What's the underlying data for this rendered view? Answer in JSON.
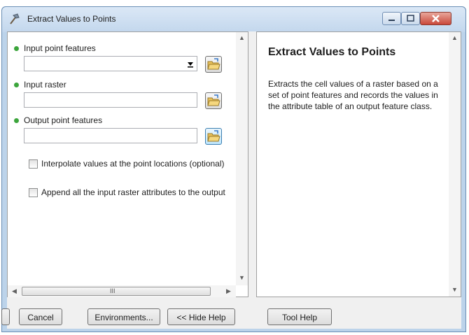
{
  "window": {
    "title": "Extract Values to Points"
  },
  "params": [
    {
      "label": "Input point features",
      "value": "",
      "kind": "combo"
    },
    {
      "label": "Input raster",
      "value": "",
      "kind": "text"
    },
    {
      "label": "Output point features",
      "value": "",
      "kind": "text"
    }
  ],
  "options": [
    {
      "label": "Interpolate values at the point locations (optional)",
      "checked": false
    },
    {
      "label": "Append all the input raster attributes to the output point features (optional)",
      "checked": false
    }
  ],
  "scrollbar": {
    "grip": "III"
  },
  "help": {
    "title": "Extract Values to Points",
    "body": "Extracts the cell values of a raster based on a set of point features and records the values in the attribute table of an output feature class."
  },
  "buttons": {
    "cancel": "Cancel",
    "environments": "Environments...",
    "hide_help": "<< Hide Help",
    "tool_help": "Tool Help"
  },
  "colors": {
    "required_dot": "#3ca53c",
    "title_bar": "#c3d7ed",
    "close_button": "#c9483a"
  },
  "icons": {
    "app": "hammer-icon",
    "browse": "open-folder-icon"
  }
}
